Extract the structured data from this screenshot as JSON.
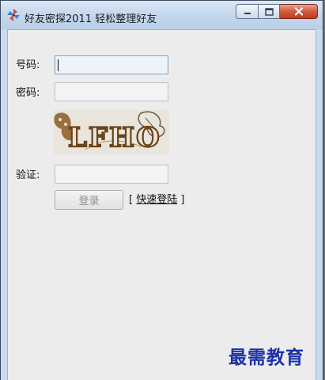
{
  "window": {
    "title": "好友密探2011 轻松整理好友",
    "icons": {
      "app": "pinwheel-icon",
      "minimize": "minimize-icon",
      "maximize": "maximize-icon",
      "close": "close-icon"
    }
  },
  "form": {
    "account_label": "号码:",
    "account_value": "",
    "password_label": "密码:",
    "password_value": "",
    "captcha_text": "LFHO",
    "verify_label": "验证:",
    "verify_value": "",
    "login_button": "登录",
    "quick_login_bracket_open": "[",
    "quick_login_link": "快速登陆",
    "quick_login_bracket_close": "]"
  },
  "watermark": "最需教育",
  "colors": {
    "title_bar": "#c5d8ee",
    "close_button": "#c7432a",
    "client_bg": "#ececec",
    "watermark": "#1c32a8"
  }
}
